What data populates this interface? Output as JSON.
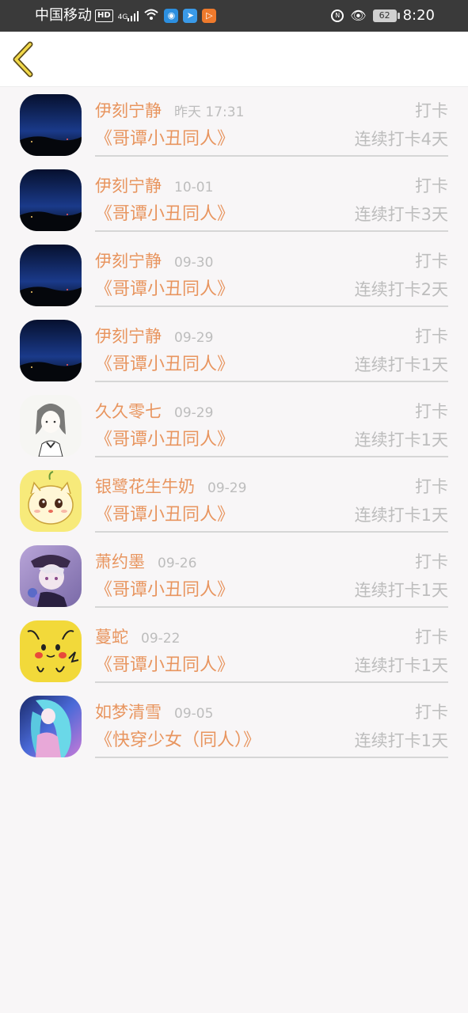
{
  "status_bar": {
    "carrier": "中国移动",
    "hd_badge": "HD",
    "network": "4G",
    "app_icons": [
      "bird-app-icon",
      "send-app-icon",
      "play-app-icon"
    ],
    "battery": "62",
    "time": "8:20"
  },
  "header": {
    "back_icon": "chevron-left-icon",
    "accent_color": "#e8955f"
  },
  "checkins": [
    {
      "name": "伊刻宁静",
      "date": "昨天 17:31",
      "action": "打卡",
      "book": "《哥谭小丑同人》",
      "streak": "连续打卡4天",
      "avatar": "night-sky"
    },
    {
      "name": "伊刻宁静",
      "date": "10-01",
      "action": "打卡",
      "book": "《哥谭小丑同人》",
      "streak": "连续打卡3天",
      "avatar": "night-sky"
    },
    {
      "name": "伊刻宁静",
      "date": "09-30",
      "action": "打卡",
      "book": "《哥谭小丑同人》",
      "streak": "连续打卡2天",
      "avatar": "night-sky"
    },
    {
      "name": "伊刻宁静",
      "date": "09-29",
      "action": "打卡",
      "book": "《哥谭小丑同人》",
      "streak": "连续打卡1天",
      "avatar": "night-sky"
    },
    {
      "name": "久久零七",
      "date": "09-29",
      "action": "打卡",
      "book": "《哥谭小丑同人》",
      "streak": "连续打卡1天",
      "avatar": "sketch-girl"
    },
    {
      "name": "银鹭花生牛奶",
      "date": "09-29",
      "action": "打卡",
      "book": "《哥谭小丑同人》",
      "streak": "连续打卡1天",
      "avatar": "yellow-cat"
    },
    {
      "name": "萧约墨",
      "date": "09-26",
      "action": "打卡",
      "book": "《哥谭小丑同人》",
      "streak": "连续打卡1天",
      "avatar": "anime-boy"
    },
    {
      "name": "蔓蛇",
      "date": "09-22",
      "action": "打卡",
      "book": "《哥谭小丑同人》",
      "streak": "连续打卡1天",
      "avatar": "pikachu"
    },
    {
      "name": "如梦清雪",
      "date": "09-05",
      "action": "打卡",
      "book": "《快穿少女（同人）》",
      "streak": "连续打卡1天",
      "avatar": "blue-hair-girl"
    }
  ]
}
